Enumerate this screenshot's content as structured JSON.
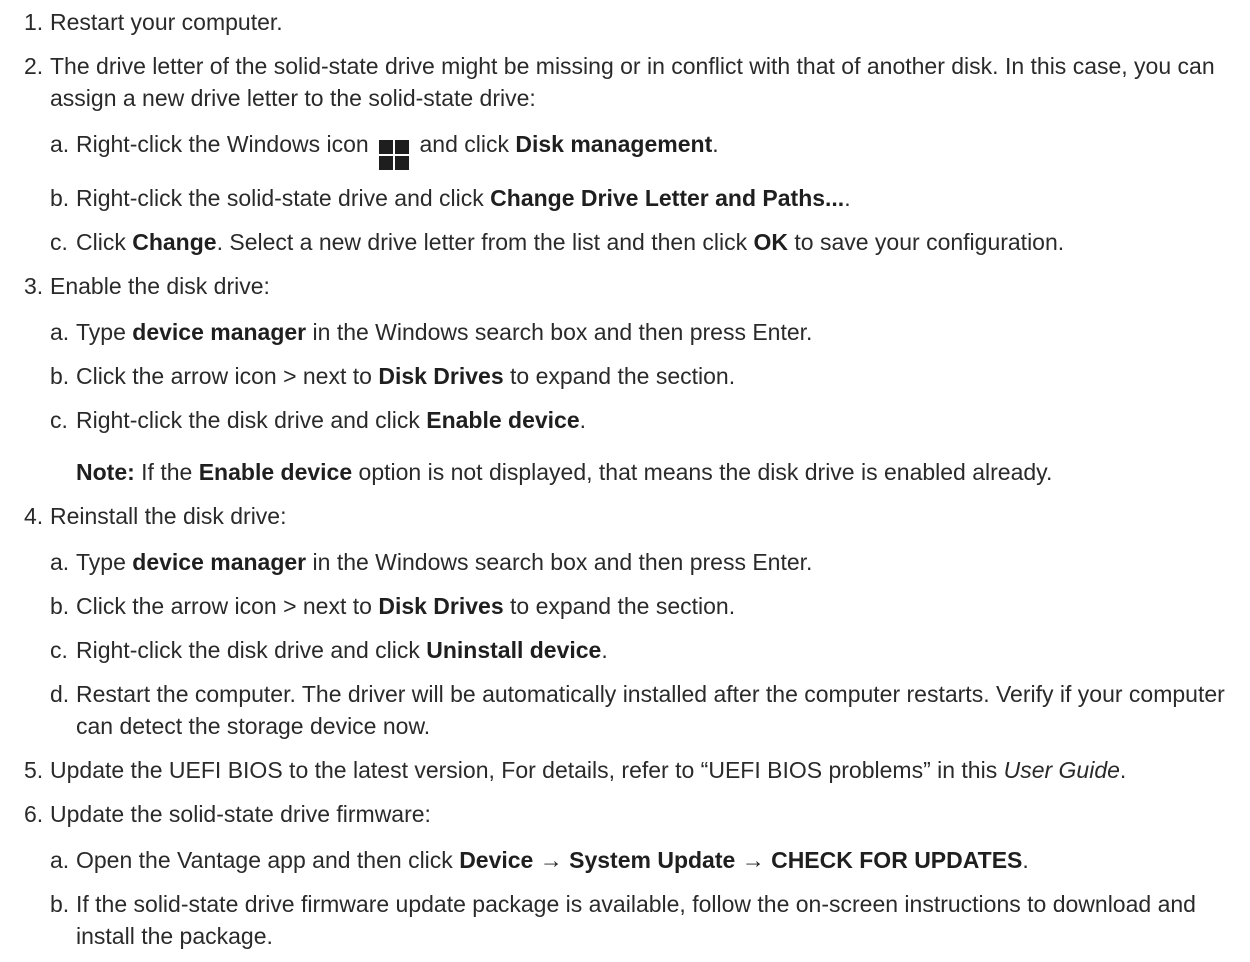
{
  "steps": [
    {
      "num": "1.",
      "text": "Restart your computer."
    },
    {
      "num": "2.",
      "text": "The drive letter of the solid-state drive might be missing or in conflict with that of another disk. In this case, you can assign a new drive letter to the solid-state drive:",
      "subs": [
        {
          "num": "a.",
          "pre": "Right-click the Windows icon",
          "mid": "and click",
          "bold": "Disk management",
          "post": "."
        },
        {
          "num": "b.",
          "pre": "Right-click the solid-state drive and click",
          "bold": "Change Drive Letter and Paths...",
          "post": "."
        },
        {
          "num": "c.",
          "pre": "Click",
          "bold1": "Change",
          "mid": ". Select a new drive letter from the list and then click",
          "bold2": "OK",
          "post": "to save your configuration."
        }
      ]
    },
    {
      "num": "3.",
      "text": "Enable the disk drive:",
      "subs": [
        {
          "num": "a.",
          "pre": "Type",
          "bold": "device manager",
          "post": "in the Windows search box and then press Enter."
        },
        {
          "num": "b.",
          "pre": "Click the arrow icon > next to",
          "bold": "Disk Drives",
          "post": "to expand the section."
        },
        {
          "num": "c.",
          "pre": "Right-click the disk drive and click",
          "bold": "Enable device",
          "post": "."
        }
      ],
      "note": {
        "label": "Note:",
        "pre": "If the",
        "bold": "Enable device",
        "post": "option is not displayed, that means the disk drive is enabled already."
      }
    },
    {
      "num": "4.",
      "text": "Reinstall the disk drive:",
      "subs": [
        {
          "num": "a.",
          "pre": "Type",
          "bold": "device manager",
          "post": "in the Windows search box and then press Enter."
        },
        {
          "num": "b.",
          "pre": "Click the arrow icon > next to",
          "bold": "Disk Drives",
          "post": "to expand the section."
        },
        {
          "num": "c.",
          "pre": "Right-click the disk drive and click",
          "bold": "Uninstall device",
          "post": "."
        },
        {
          "num": "d.",
          "text": "Restart the computer. The driver will be automatically installed after the computer restarts. Verify if your computer can detect the storage device now."
        }
      ]
    },
    {
      "num": "5.",
      "pre": "Update the UEFI BIOS to the latest version, For details, refer to “UEFI BIOS problems” in this",
      "italic": "User Guide",
      "post": "."
    },
    {
      "num": "6.",
      "text": "Update the solid-state drive firmware:",
      "subs": [
        {
          "num": "a.",
          "pre": "Open the Vantage app and then click",
          "bold": "Device → System Update → CHECK FOR UPDATES",
          "post": "."
        },
        {
          "num": "b.",
          "text": "If the solid-state drive firmware update package is available, follow the on-screen instructions to download and install the package."
        }
      ]
    }
  ]
}
